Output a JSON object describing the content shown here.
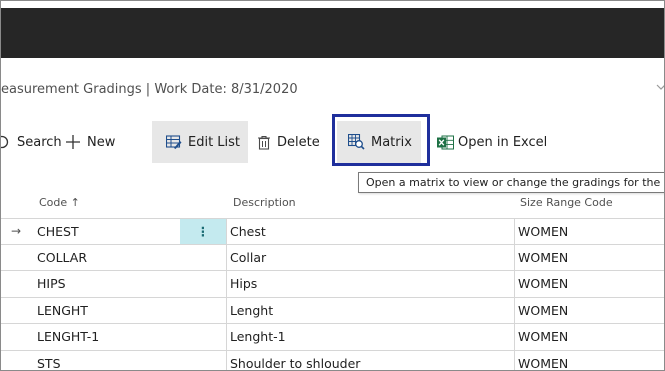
{
  "page": {
    "title": "easurement Gradings | Work Date: 8/31/2020"
  },
  "actions": {
    "search_label": "Search",
    "new_label": "New",
    "edit_list_label": "Edit List",
    "delete_label": "Delete",
    "matrix_label": "Matrix",
    "excel_label": "Open in Excel"
  },
  "tooltip": {
    "text": "Open a matrix to view or change the gradings for the ir"
  },
  "table": {
    "headers": {
      "code": "Code ↑",
      "description": "Description",
      "size_range": "Size Range Code"
    },
    "selected_row_marker": "→",
    "row_menu_glyph": "⋮",
    "rows": [
      {
        "code": "CHEST",
        "description": "Chest",
        "size_range": "WOMEN"
      },
      {
        "code": "COLLAR",
        "description": "Collar",
        "size_range": "WOMEN"
      },
      {
        "code": "HIPS",
        "description": "Hips",
        "size_range": "WOMEN"
      },
      {
        "code": "LENGHT",
        "description": "Lenght",
        "size_range": "WOMEN"
      },
      {
        "code": "LENGHT-1",
        "description": "Lenght-1",
        "size_range": "WOMEN"
      },
      {
        "code": "STS",
        "description": "Shoulder to shlouder",
        "size_range": "WOMEN"
      }
    ]
  },
  "colors": {
    "accent_highlight": "#1f2f9c",
    "topbar": "#262626",
    "excel_green": "#1e7145",
    "active_cell": "#c4eaef"
  },
  "icons": {
    "search": "search-icon",
    "new": "plus-icon",
    "edit_list": "edit-list-icon",
    "delete": "trash-icon",
    "matrix": "matrix-icon",
    "excel": "excel-icon",
    "chevron": "chevron-down-icon"
  }
}
